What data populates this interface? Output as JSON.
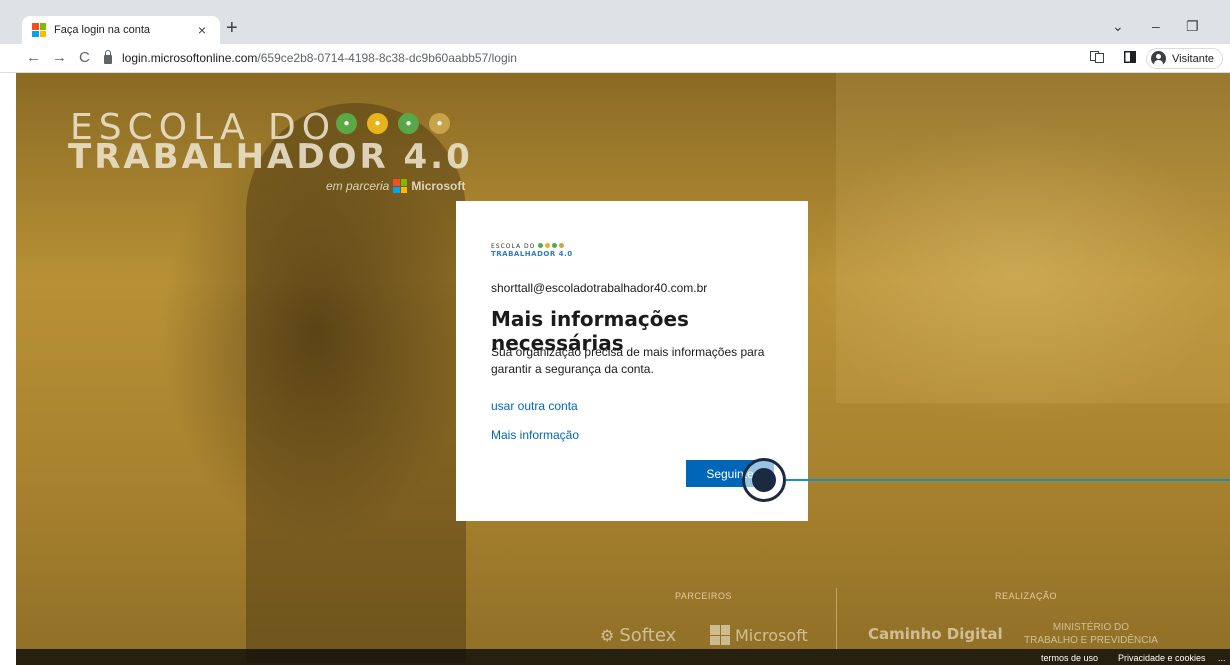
{
  "browser": {
    "tab_title": "Faça login na conta",
    "tab_close": "×",
    "new_tab": "+",
    "url_host": "login.microsoftonline.com",
    "url_path": "/659ce2b8-0714-4198-8c38-dc9b60aabb57/login",
    "profile_label": "Visitante",
    "nav": {
      "back": "←",
      "forward": "→",
      "reload": "C"
    },
    "window": {
      "chevron": "⌄",
      "minimize": "–",
      "restore": "❐"
    }
  },
  "background": {
    "logo_line1": "ESCOLA DO",
    "logo_line2": "TRABALHADOR 4.0",
    "partner_text": "em parceria",
    "partner_brand": "Microsoft",
    "dot_colors": [
      "#5aa846",
      "#e8b41e",
      "#58a84a",
      "#c9a24a"
    ]
  },
  "card": {
    "logo_line1": "ESCOLA DO",
    "logo_line2": "TRABALHADOR 4.0",
    "email": "shorttall@escoladotrabalhador40.com.br",
    "title": "Mais informações necessárias",
    "description": "Sua organização precisa de mais informações para garantir a segurança da conta.",
    "link_other_account": "usar outra conta",
    "link_more_info": "Mais informação",
    "next_button": "Seguinte"
  },
  "partners": {
    "label_partners": "PARCEIROS",
    "label_realization": "REALIZAÇÃO",
    "softex": "Softex",
    "microsoft": "Microsoft",
    "caminho": "Caminho Digital",
    "ministerio_line1": "MINISTÉRIO DO",
    "ministerio_line2": "TRABALHO E PREVIDÊNCIA"
  },
  "footer": {
    "terms": "termos de uso",
    "privacy": "Privacidade e cookies",
    "more": "..."
  },
  "colors": {
    "accent": "#0067b8",
    "ms_red": "#f25022",
    "ms_green": "#7fba00",
    "ms_blue": "#00a4ef",
    "ms_yellow": "#ffb900"
  }
}
